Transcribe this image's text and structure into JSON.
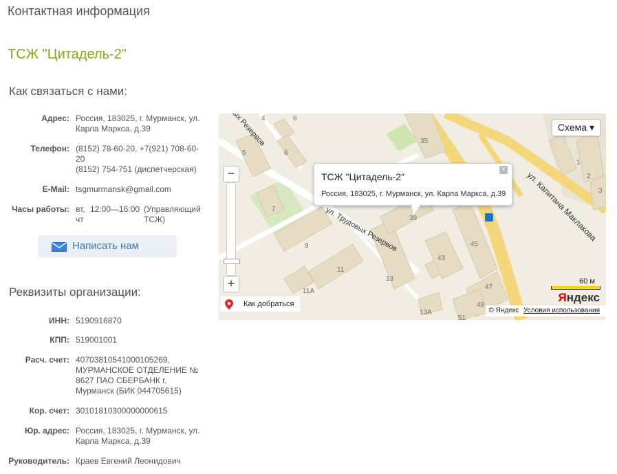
{
  "page_title": "Контактная информация",
  "org_name": "ТСЖ \"Цитадель-2\"",
  "contacts": {
    "heading": "Как связаться с нами:",
    "address_label": "Адрес:",
    "address_line1": "Россия, 183025, г. Мурманск, ул.",
    "address_line2": "Карла Маркса, д.39",
    "phone_label": "Телефон:",
    "phone_line1": "(8152) 78-60-20, +7(921) 708-60-",
    "phone_line2": "20",
    "phone_line3": "(8152) 754-751 (диспетчерская)",
    "email_label": "E-Mail:",
    "email_value": "tsgmurmansk@gmail.com",
    "hours_label": "Часы работы:",
    "hours_days": "вт,",
    "hours_days2": "чт",
    "hours_time": "12:00—16:00",
    "hours_note1": "(Управляющий",
    "hours_note2": "ТСЖ)",
    "write_button": "Написать нам"
  },
  "requisites": {
    "heading": "Реквизиты организации:",
    "inn_label": "ИНН:",
    "inn_value": "5190916870",
    "kpp_label": "КПП:",
    "kpp_value": "519001001",
    "account_label": "Расч. счет:",
    "account_line1": "40703810541000105269,",
    "account_line2": "МУРМАНСКОЕ ОТДЕЛЕНИЕ №",
    "account_line3": "8627 ПАО СБЕРБАНК г.",
    "account_line4": "Мурманск (БИК 044705615)",
    "corr_label": "Кор. счет:",
    "corr_value": "30101810300000000615",
    "legal_label": "Юр. адрес:",
    "legal_line1": "Россия, 183025, г. Мурманск, ул.",
    "legal_line2": "Карла Маркса, д.39",
    "head_label": "Руководитель:",
    "head_value": "Краев Евгений Леонидович"
  },
  "map": {
    "scheme_button": "Схема",
    "balloon_title": "ТСЖ \"Цитадель-2\"",
    "balloon_address": "Россия, 183025, г. Мурманск, ул. Карла Маркса, д.39",
    "route_label": "Как добраться",
    "scale_label": "60 м",
    "logo_y": "Я",
    "logo_rest": "ндекс",
    "copyright": "© Яндекс",
    "terms": "Условия использования",
    "street1": "ул. Трудовых Резервов",
    "street2": "ул. Капитана Маклакова",
    "street3": "ых Резервов",
    "house_numbers": [
      "4",
      "5",
      "6",
      "7",
      "8",
      "9",
      "11",
      "11А",
      "13",
      "13А",
      "35",
      "39",
      "43",
      "45",
      "47",
      "49",
      "51",
      "1",
      "2",
      "3"
    ],
    "zoom_in": "+",
    "zoom_out": "−",
    "close": "×",
    "accent_road": "#f4d77a",
    "building": "#e6dcc4"
  }
}
